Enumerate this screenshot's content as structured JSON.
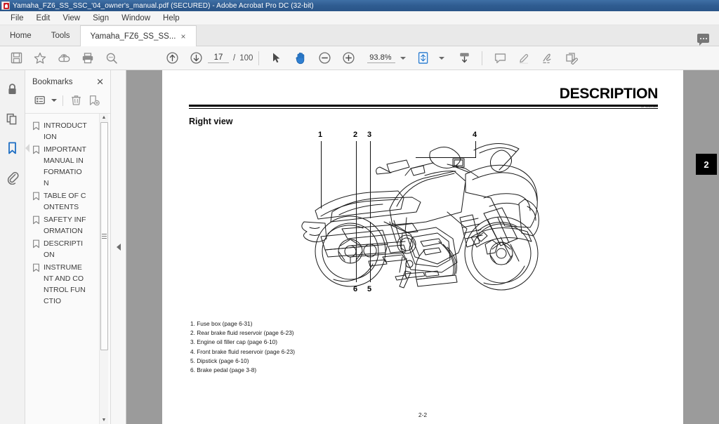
{
  "window": {
    "title": "Yamaha_FZ6_SS_SSC_'04_owner's_manual.pdf (SECURED) - Adobe Acrobat Pro DC (32-bit)",
    "app_icon": "acrobat-icon"
  },
  "menubar": {
    "items": [
      {
        "label": "File"
      },
      {
        "label": "Edit"
      },
      {
        "label": "View"
      },
      {
        "label": "Sign"
      },
      {
        "label": "Window"
      },
      {
        "label": "Help"
      }
    ]
  },
  "tabbar": {
    "home_label": "Home",
    "tools_label": "Tools",
    "document_tab_label": "Yamaha_FZ6_SS_SS...",
    "close_glyph": "×",
    "comment_icon": "comment-bubble-icon"
  },
  "toolbar": {
    "save_icon": "save-icon",
    "star_icon": "star-icon",
    "upload_cloud_icon": "upload-to-cloud-icon",
    "print_icon": "print-icon",
    "search_icon": "search-icon",
    "previous_page_icon": "previous-page-icon",
    "next_page_icon": "next-page-icon",
    "page_number": "17",
    "page_separator": "/",
    "page_total": "100",
    "select_tool_icon": "select-cursor-icon",
    "hand_tool_icon": "hand-tool-icon",
    "zoom_out_icon": "zoom-out-icon",
    "zoom_in_icon": "zoom-in-icon",
    "zoom_level": "93.8%",
    "page_fit_icon": "page-fit-icon",
    "scroll_mode_icon": "scroll-mode-icon",
    "comment_icon": "comment-icon",
    "highlight_icon": "highlight-icon",
    "signature_icon": "signature-icon",
    "stamp_icon": "stamp-icon"
  },
  "rail": {
    "items": [
      {
        "name": "security-lock-icon",
        "active": false
      },
      {
        "name": "page-thumbnails-icon",
        "active": false
      },
      {
        "name": "bookmarks-icon",
        "active": true
      },
      {
        "name": "attachments-icon",
        "active": false
      }
    ]
  },
  "panel": {
    "title": "Bookmarks",
    "close_glyph": "✕",
    "options_icon": "bookmark-options-icon",
    "delete_icon": "delete-bookmark-icon",
    "new_icon": "new-bookmark-icon",
    "bookmarks": [
      {
        "label": "INTRODUCTION"
      },
      {
        "label": "IMPORTANT MANUAL INFORMATION"
      },
      {
        "label": "TABLE OF CONTENTS"
      },
      {
        "label": "SAFETY INFORMATION"
      },
      {
        "label": "DESCRIPTION"
      },
      {
        "label": "INSTRUMENT AND CONTROL FUNCTIO"
      }
    ],
    "scroll_up_glyph": "▲",
    "scroll_down_glyph": "▼"
  },
  "document": {
    "header_title": "DESCRIPTION",
    "section_title": "Right view",
    "reference_code": "EAU10420",
    "callouts": [
      {
        "number": "1"
      },
      {
        "number": "2"
      },
      {
        "number": "3"
      },
      {
        "number": "4"
      },
      {
        "number": "5"
      },
      {
        "number": "6"
      }
    ],
    "legend": [
      {
        "text": "1. Fuse box (page 6-31)"
      },
      {
        "text": "2. Rear brake fluid reservoir (page 6-23)"
      },
      {
        "text": "3. Engine oil filler cap (page 6-10)"
      },
      {
        "text": "4. Front brake fluid reservoir (page 6-23)"
      },
      {
        "text": "5. Dipstick (page 6-10)"
      },
      {
        "text": "6. Brake pedal (page 3-8)"
      }
    ],
    "page_footer": "2-2",
    "chapter_tab": "2",
    "figure_name": "motorcycle-right-view-illustration"
  }
}
